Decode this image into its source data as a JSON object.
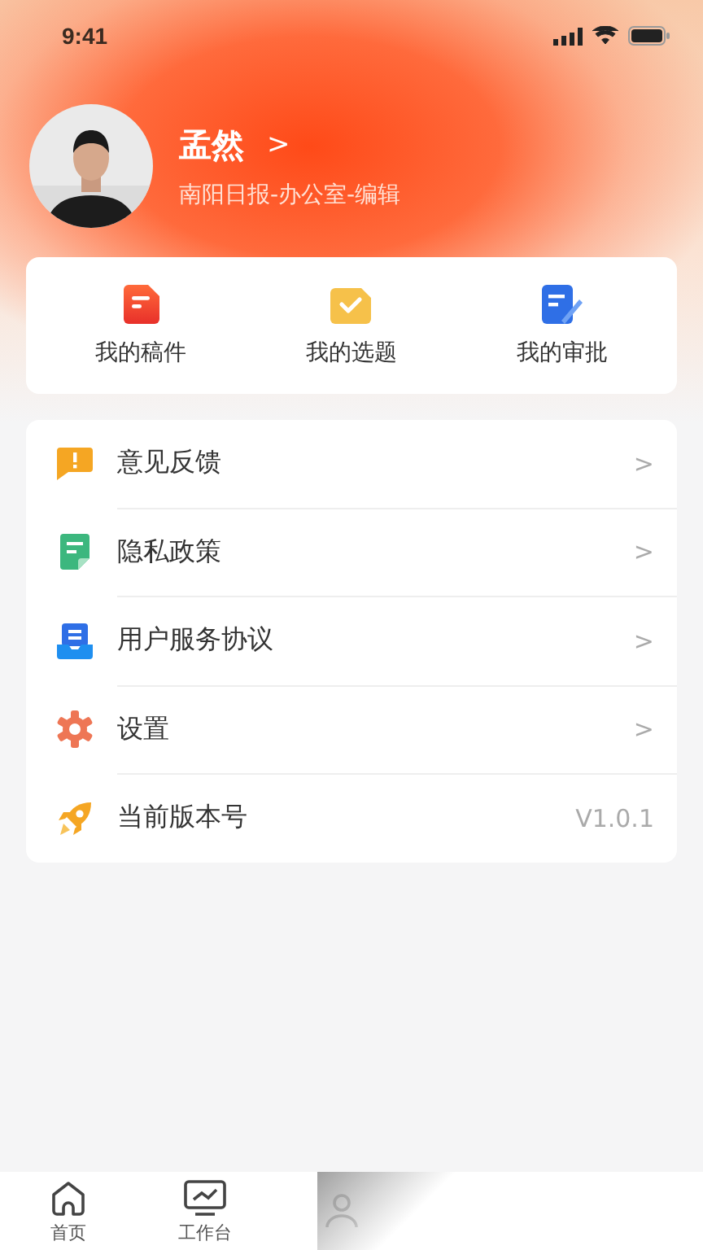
{
  "status_bar": {
    "time": "9:41"
  },
  "profile": {
    "name": "孟然",
    "chevron": ">",
    "org": "南阳日报-办公室-编辑"
  },
  "shortcuts": [
    {
      "label": "我的稿件",
      "kind": "drafts"
    },
    {
      "label": "我的选题",
      "kind": "topics"
    },
    {
      "label": "我的审批",
      "kind": "approvals"
    }
  ],
  "menu": [
    {
      "label": "意见反馈",
      "kind": "feedback",
      "trailing": ">"
    },
    {
      "label": "隐私政策",
      "kind": "privacy",
      "trailing": ">"
    },
    {
      "label": "用户服务协议",
      "kind": "agreement",
      "trailing": ">"
    },
    {
      "label": "设置",
      "kind": "settings",
      "trailing": ">"
    },
    {
      "label": "当前版本号",
      "kind": "version",
      "trailing": "V1.0.1"
    }
  ],
  "tab_bar": [
    {
      "label": "首页",
      "kind": "home"
    },
    {
      "label": "工作台",
      "kind": "workbench"
    },
    {
      "kind": "contacts"
    }
  ]
}
